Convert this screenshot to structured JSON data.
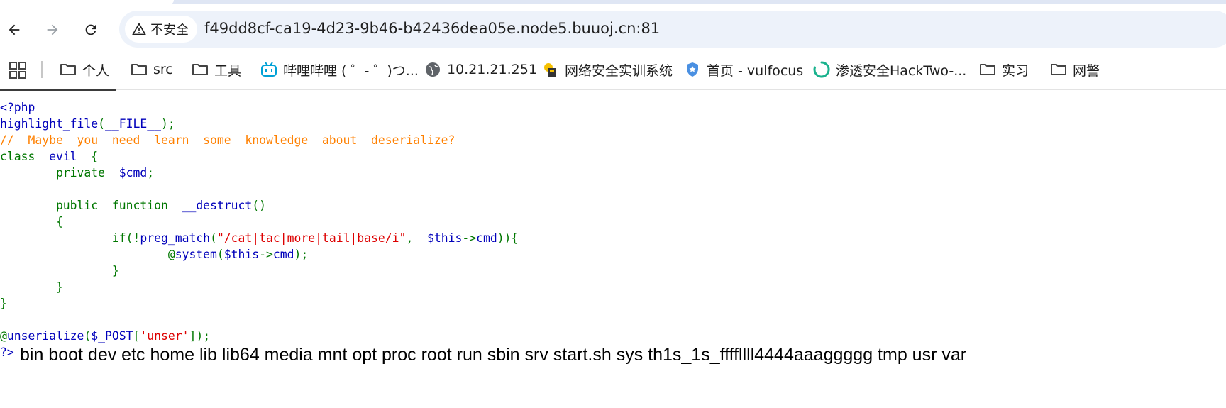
{
  "browser": {
    "security_label": "不安全",
    "url": "f49dd8cf-ca19-4d23-9b46-b42436dea05e.node5.buuoj.cn:81",
    "icons": {
      "back": "arrow-left-icon",
      "forward": "arrow-right-icon",
      "reload": "reload-icon",
      "security": "warning-triangle-icon",
      "apps": "apps-grid-icon"
    }
  },
  "bookmarks": [
    {
      "label": "个人",
      "icon": "folder-icon"
    },
    {
      "label": "src",
      "icon": "folder-icon"
    },
    {
      "label": "工具",
      "icon": "folder-icon"
    },
    {
      "label": "哔哩哔哩 ( ゜- ゜)つ...",
      "icon": "bilibili-icon"
    },
    {
      "label": "10.21.21.251",
      "icon": "globe-icon"
    },
    {
      "label": "网络安全实训系统",
      "icon": "site-icon"
    },
    {
      "label": "首页 - vulfocus",
      "icon": "shield-icon"
    },
    {
      "label": "渗透安全HackTwo-...",
      "icon": "circle-loader-icon"
    },
    {
      "label": "实习",
      "icon": "folder-icon"
    },
    {
      "label": "网警",
      "icon": "folder-icon"
    }
  ],
  "code": {
    "l1": "<?php",
    "l2a": "highlight_file",
    "l2b": "(",
    "l2c": "__FILE__",
    "l2d": ");",
    "l3": "//  Maybe  you  need  learn  some  knowledge  about  deserialize?",
    "l4a": "class  ",
    "l4b": "evil  ",
    "l4c": "{",
    "l5a": "        private  ",
    "l5b": "$cmd",
    "l5c": ";",
    "l7a": "        public  function  ",
    "l7b": "__destruct",
    "l7c": "()",
    "l8": "        {",
    "l9a": "                if(!",
    "l9b": "preg_match",
    "l9c": "(",
    "l9d": "\"/cat|tac|more|tail|base/i\"",
    "l9e": ",  ",
    "l9f": "$this",
    "l9g": "->",
    "l9h": "cmd",
    "l9i": ")){",
    "l10a": "                        @",
    "l10b": "system",
    "l10c": "(",
    "l10d": "$this",
    "l10e": "->",
    "l10f": "cmd",
    "l10g": ");",
    "l11": "                }",
    "l12": "        }",
    "l13": "}",
    "l15a": "@",
    "l15b": "unserialize",
    "l15c": "(",
    "l15d": "$_POST",
    "l15e": "[",
    "l15f": "'unser'",
    "l15g": "]);",
    "l16": "?>"
  },
  "output": "bin boot dev etc home lib lib64 media mnt opt proc root run sbin srv start.sh sys th1s_1s_ffffllll4444aaaggggg tmp usr var"
}
